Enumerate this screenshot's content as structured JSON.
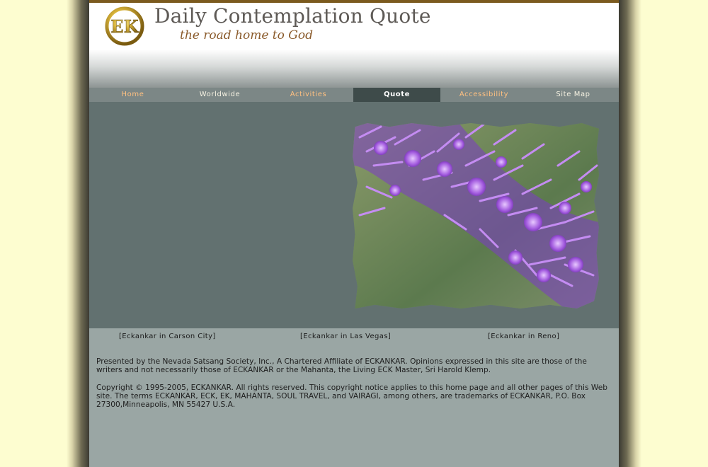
{
  "header": {
    "title": "Daily Contemplation Quote",
    "tagline": "the road home to God",
    "logo_text": "EK"
  },
  "nav": {
    "items": [
      {
        "label": "Home"
      },
      {
        "label": "Worldwide"
      },
      {
        "label": "Activities"
      },
      {
        "label": "Quote"
      },
      {
        "label": "Accessibility"
      },
      {
        "label": "Site Map"
      }
    ],
    "active": "Quote"
  },
  "photo": {
    "icon": "purple-flower-photo"
  },
  "locations": {
    "carson_city": "[Eckankar in Carson City]",
    "las_vegas": "[Eckankar in Las Vegas]",
    "reno": "[Eckankar in Reno]"
  },
  "footer": {
    "disclaimer": "Presented by the Nevada Satsang Society, Inc., A Chartered Affiliate of ECKANKAR. Opinions expressed in this site are those of the writers and not necessarily those of ECKANKAR or the Mahanta, the Living ECK Master, Sri Harold Klemp.",
    "copyright": "Copyright © 1995-2005, ECKANKAR. All rights reserved. This copyright notice applies to this home page and all other pages of this Web site. The terms ECKANKAR, ECK, EK, MAHANTA, SOUL TRAVEL, and VAIRAGI, among others, are trademarks of ECKANKAR, P.O. Box 27300,Minneapolis, MN 55427 U.S.A."
  },
  "colors": {
    "background": "#fdfdd0",
    "page": "#9aa6a4",
    "content": "#627170",
    "nav": "#7c8786",
    "nav_active": "#3e4b4a",
    "nav_orange": "#ffc080",
    "title": "#5e5a56",
    "tagline": "#8a5a2a",
    "top_bar": "#7b5a1e"
  }
}
